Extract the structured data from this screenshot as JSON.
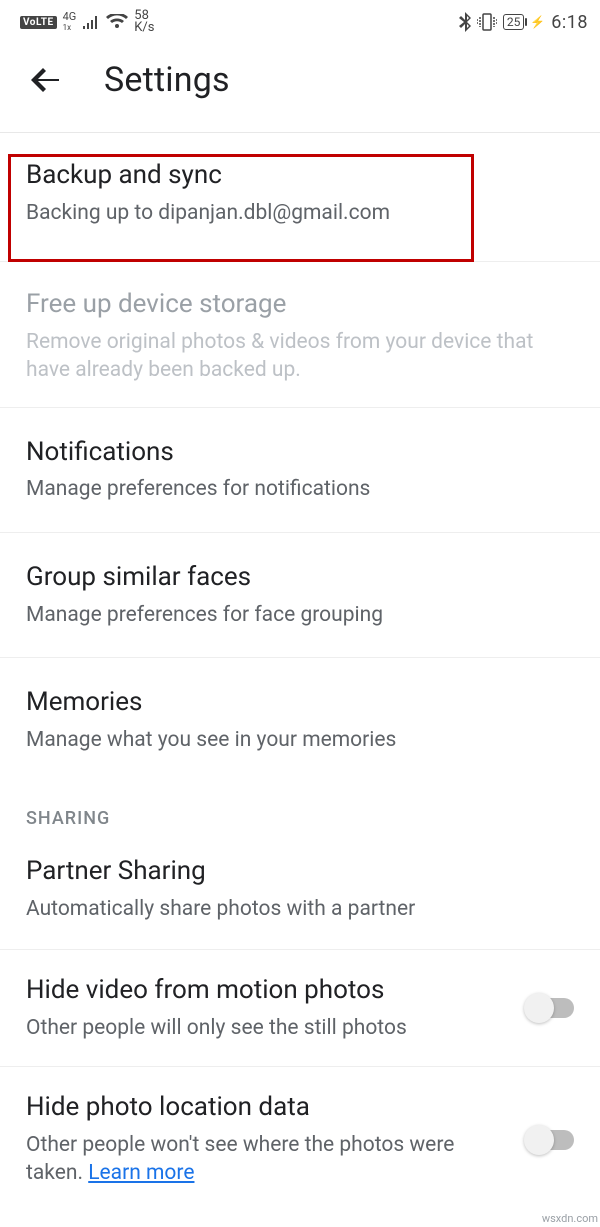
{
  "status": {
    "volte": "VoLTE",
    "lte_top": "4G",
    "lte_bottom": "1x",
    "speed_top": "58",
    "speed_bottom": "K/s",
    "battery": "25",
    "time": "6:18"
  },
  "appbar": {
    "title": "Settings"
  },
  "items": {
    "backup": {
      "title": "Backup and sync",
      "sub": "Backing up to dipanjan.dbl@gmail.com"
    },
    "freeup": {
      "title": "Free up device storage",
      "sub": "Remove original photos & videos from your device that have already been backed up."
    },
    "notifications": {
      "title": "Notifications",
      "sub": "Manage preferences for notifications"
    },
    "faces": {
      "title": "Group similar faces",
      "sub": "Manage preferences for face grouping"
    },
    "memories": {
      "title": "Memories",
      "sub": "Manage what you see in your memories"
    },
    "section_sharing": "SHARING",
    "partner": {
      "title": "Partner Sharing",
      "sub": "Automatically share photos with a partner"
    },
    "hidevideo": {
      "title": "Hide video from motion photos",
      "sub": "Other people will only see the still photos"
    },
    "hidelocation": {
      "title": "Hide photo location data",
      "sub": "Other people won't see where the photos were taken.  ",
      "link": "Learn more"
    }
  },
  "watermark": "wsxdn.com"
}
